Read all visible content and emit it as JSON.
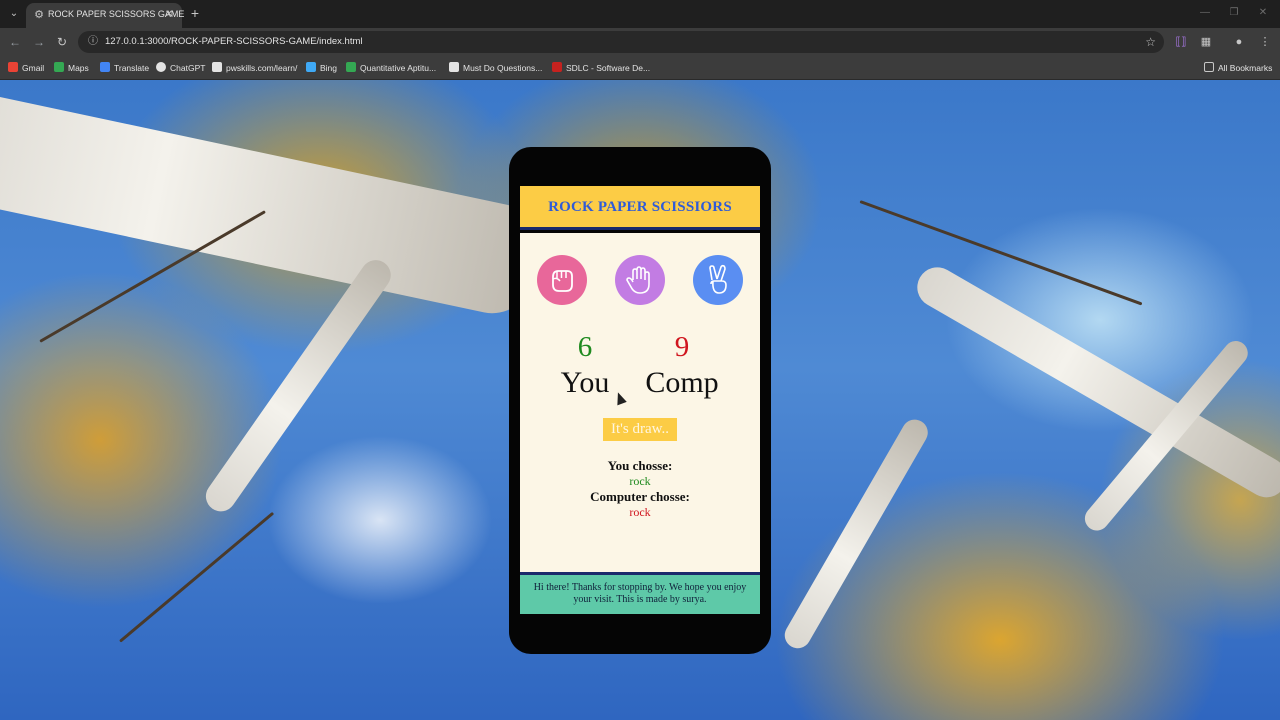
{
  "browser": {
    "tab_title": "ROCK PAPER SCISSORS GAME",
    "url": "127.0.0.1:3000/ROCK-PAPER-SCISSORS-GAME/index.html",
    "bookmarks": [
      {
        "label": "Gmail",
        "color": "#ea4335"
      },
      {
        "label": "Maps",
        "color": "#34a853"
      },
      {
        "label": "Translate",
        "color": "#4285f4"
      },
      {
        "label": "ChatGPT",
        "color": "#e3e3e3"
      },
      {
        "label": "pwskills.com/learn/",
        "color": "#e3e3e3"
      },
      {
        "label": "Bing",
        "color": "#3fa9f5"
      },
      {
        "label": "Quantitative Aptitu...",
        "color": "#34a853"
      },
      {
        "label": "Must Do Questions...",
        "color": "#e3e3e3"
      },
      {
        "label": "SDLC - Software De...",
        "color": "#c5221f"
      }
    ],
    "all_bookmarks": "All Bookmarks"
  },
  "game": {
    "title": "ROCK PAPER SCISSIORS",
    "choices": [
      "rock-icon",
      "paper-icon",
      "scissors-icon"
    ],
    "user_score": "6",
    "comp_score": "9",
    "user_label": "You",
    "comp_label": "Comp",
    "message": "It's draw..",
    "you_chose_label": "You chosse:",
    "you_chose_value": "rock",
    "comp_chose_label": "Computer chosse:",
    "comp_chose_value": "rock",
    "footer": "Hi there! Thanks for stopping by. We hope you enjoy your visit. This is made by surya."
  },
  "colors": {
    "header": "#fccc45",
    "title": "#2f5bd8",
    "rock": "#e8679a",
    "paper": "#c27ce3",
    "scissors": "#5a8ef2",
    "footer": "#5ec9a8",
    "win": "#1f8a1f",
    "lose": "#d0161f"
  }
}
